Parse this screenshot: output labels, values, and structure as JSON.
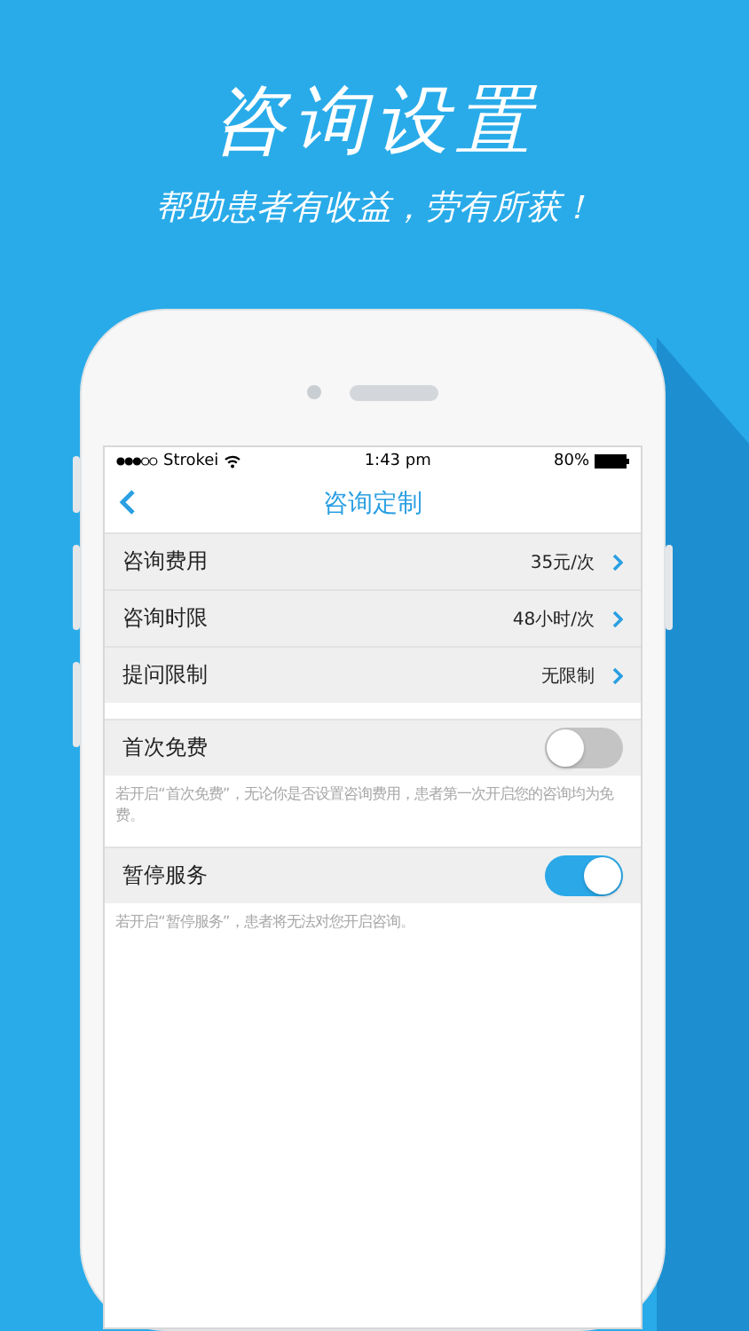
{
  "headline": "咨询设置",
  "subtitle": "帮助患者有收益，劳有所获！",
  "status_bar": {
    "carrier": "Strokei",
    "time": "1:43 pm",
    "battery": "80%"
  },
  "nav": {
    "title": "咨询定制"
  },
  "settings": [
    {
      "label": "咨询费用",
      "value": "35元/次"
    },
    {
      "label": "咨询时限",
      "value": "48小时/次"
    },
    {
      "label": "提问限制",
      "value": "无限制"
    }
  ],
  "toggles": [
    {
      "label": "首次免费",
      "on": false,
      "note": "若开启“首次免费”，无论你是否设置咨询费用，患者第一次开启您的咨询均为免费。"
    },
    {
      "label": "暂停服务",
      "on": true,
      "note": "若开启“暂停服务”，患者将无法对您开启咨询。"
    }
  ]
}
